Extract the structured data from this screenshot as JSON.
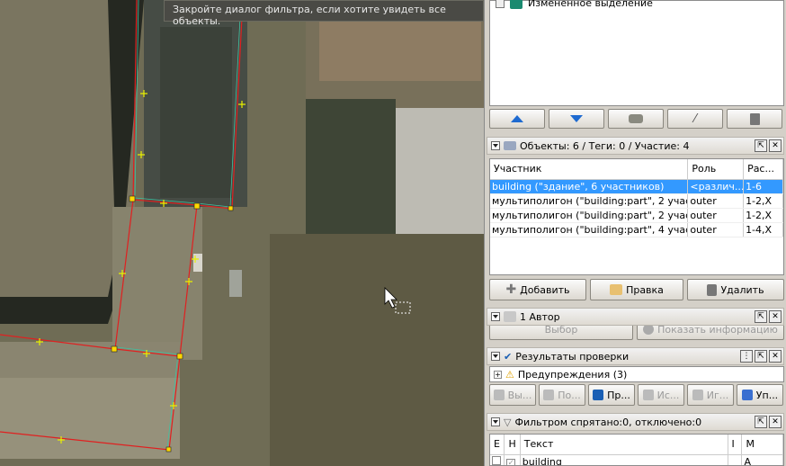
{
  "map": {
    "tooltip": "Закройте диалог фильтра, если хотите увидеть все объекты."
  },
  "layers": {
    "item_label": "Изменённое выделение"
  },
  "layer_buttons": [
    "up-arrow-icon",
    "down-arrow-icon",
    "merge-icon",
    "visibility-icon",
    "delete-icon"
  ],
  "relation": {
    "title": "Объекты: 6 / Теги: 0 / Участие: 4",
    "columns": [
      "Участник",
      "Роль",
      "Рас..."
    ],
    "rows": [
      {
        "member": "building (\"здание\", 6 участников)",
        "role": "<различ...",
        "pos": "1-6",
        "selected": true
      },
      {
        "member": "мультиполигон (\"building:part\", 2 участн...",
        "role": "outer",
        "pos": "1-2,X",
        "selected": false
      },
      {
        "member": "мультиполигон (\"building:part\", 2 участн...",
        "role": "outer",
        "pos": "1-2,X",
        "selected": false
      },
      {
        "member": "мультиполигон (\"building:part\", 4 участн...",
        "role": "outer",
        "pos": "1-4,X",
        "selected": false
      }
    ],
    "add_label": "Добавить",
    "edit_label": "Правка",
    "delete_label": "Удалить"
  },
  "author": {
    "title": "1 Автор",
    "select_label": "Выбор",
    "info_label": "Показать информацию"
  },
  "validation": {
    "title": "Результаты проверки",
    "warnings": "Предупреждения (3)",
    "buttons": [
      "Вы...",
      "По...",
      "Пр...",
      "Ис...",
      "Иг...",
      "Уп..."
    ]
  },
  "filter": {
    "title": "Фильтром спрятано:0, отключено:0",
    "columns": [
      "E",
      "H",
      "Текст",
      "I",
      "M"
    ],
    "rows": [
      {
        "text": "building",
        "m": "A"
      }
    ]
  },
  "colors": {
    "selection": "#3399ff",
    "warning": "#f0c419",
    "check": "#1a5fb4"
  }
}
